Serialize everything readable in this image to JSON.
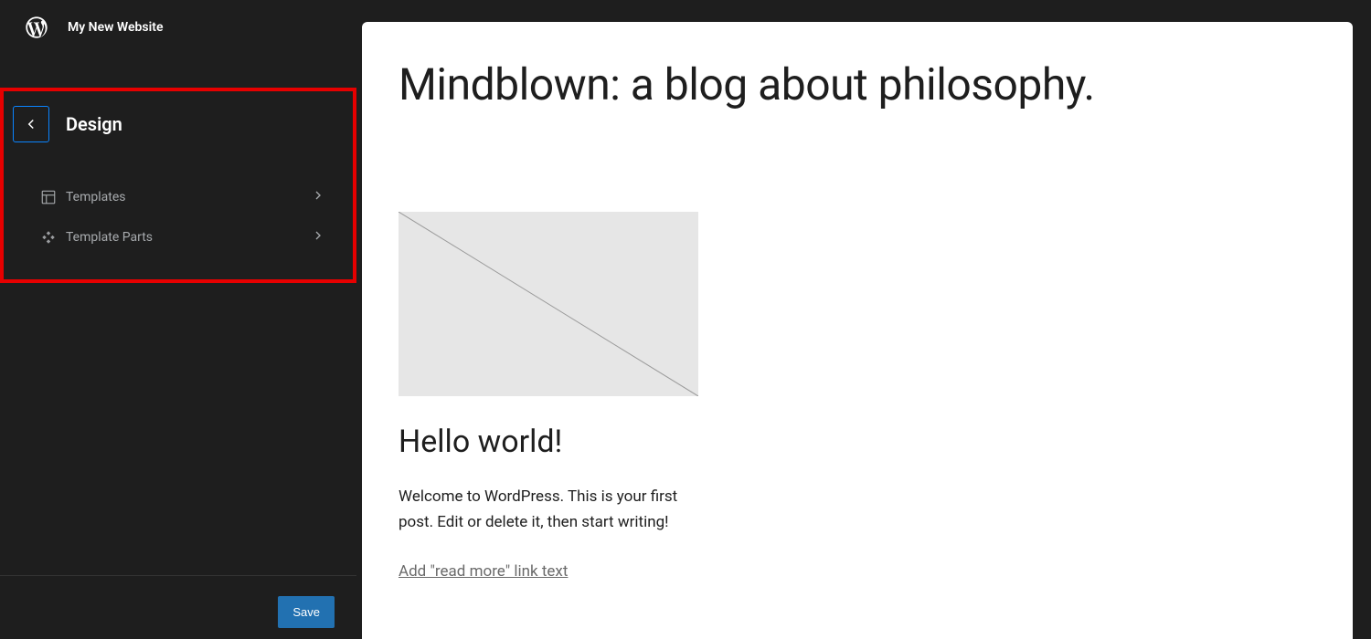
{
  "header": {
    "site_title": "My New Website"
  },
  "sidebar": {
    "panel_title": "Design",
    "items": [
      {
        "label": "Templates"
      },
      {
        "label": "Template Parts"
      }
    ],
    "save_label": "Save"
  },
  "preview": {
    "blog_title": "Mindblown: a blog about philosophy.",
    "post": {
      "title": "Hello world!",
      "excerpt": "Welcome to WordPress. This is your first post. Edit or delete it, then start writing!",
      "read_more_placeholder": "Add \"read more\" link text"
    }
  },
  "colors": {
    "highlight": "#e60000",
    "accent": "#2271b1",
    "focus": "#0a84ff"
  }
}
